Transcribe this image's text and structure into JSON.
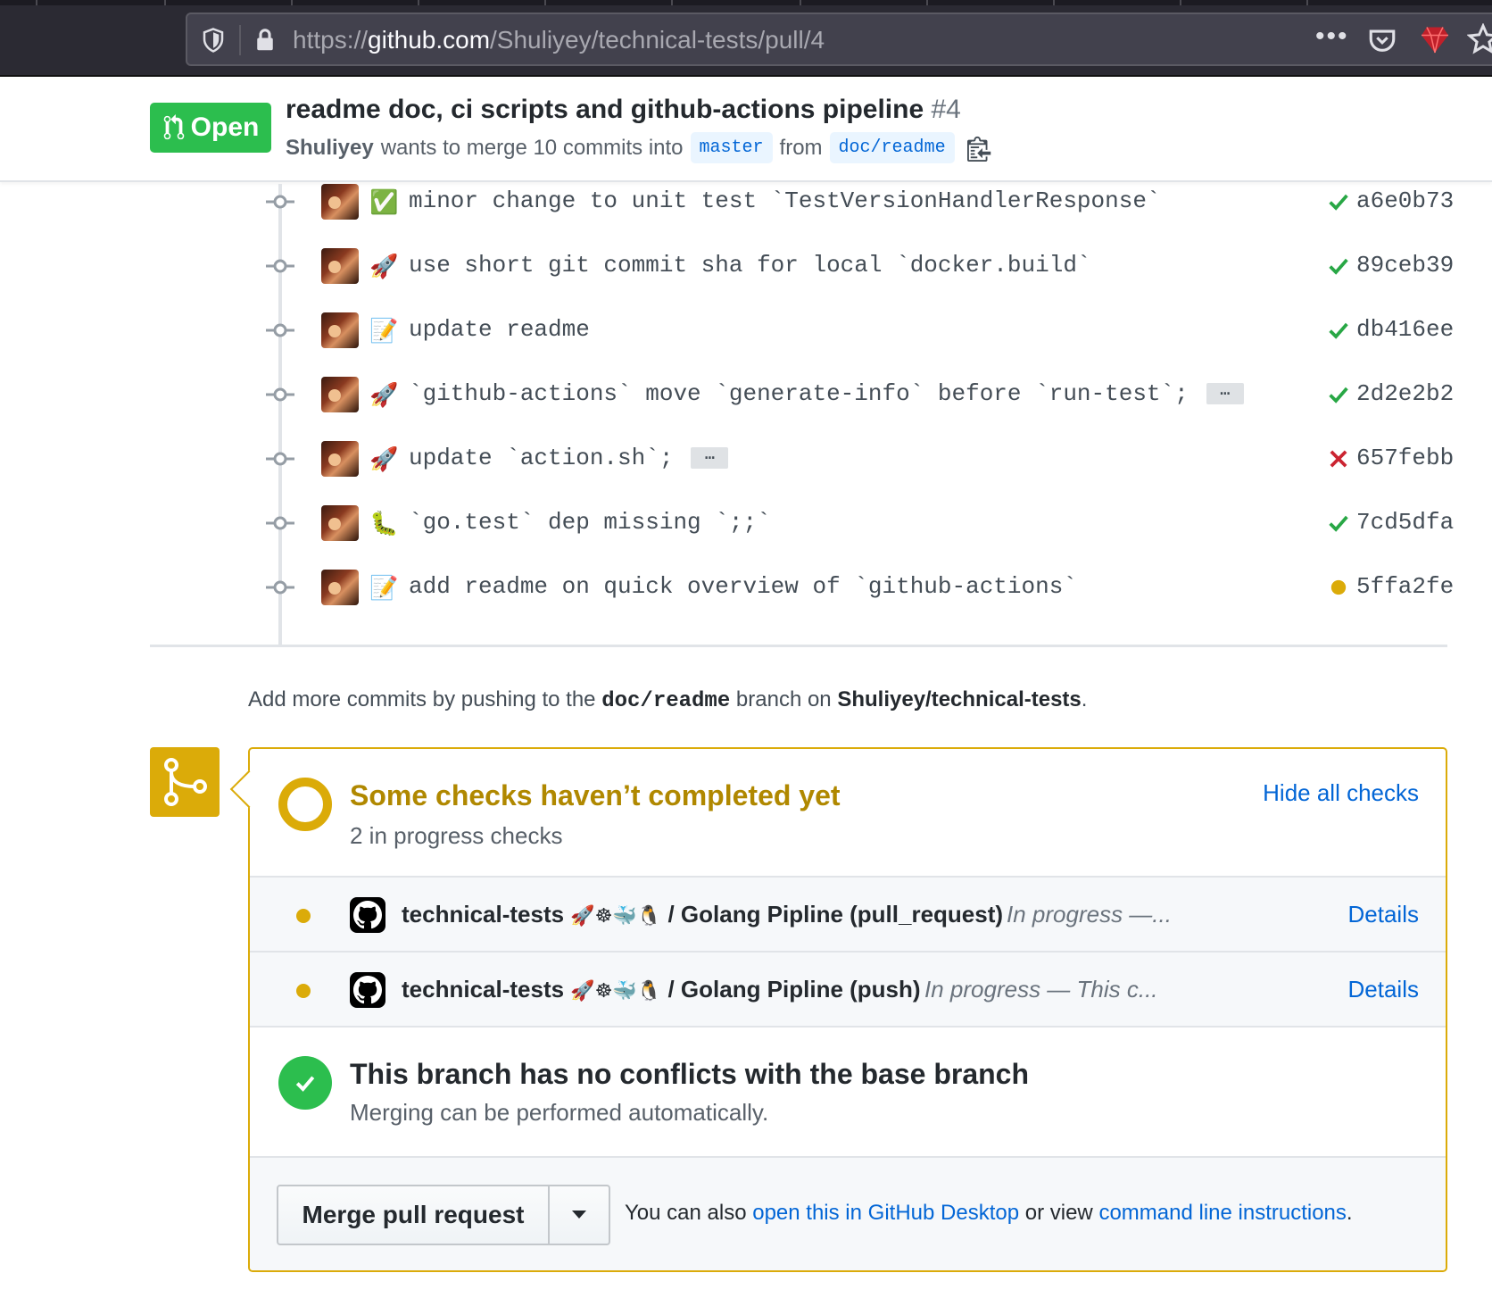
{
  "browser": {
    "url_prefix": "https://",
    "url_host": "github.com",
    "url_path": "/Shuliyey/technical-tests/pull/4",
    "menu_dots": "•••"
  },
  "pr": {
    "state_label": "Open",
    "title": "readme doc, ci scripts and github-actions pipeline",
    "number": "#4",
    "author": "Shuliyey",
    "merge_text_1": "wants to merge 10 commits into",
    "base_branch": "master",
    "merge_text_2": "from",
    "head_branch": "doc/readme"
  },
  "commits": [
    {
      "emoji": "✅",
      "message": "minor change to unit test `TestVersionHandlerResponse`",
      "status": "success",
      "sha": "a6e0b73",
      "expandable": false
    },
    {
      "emoji": "🚀",
      "message": "use short git commit sha for local `docker.build`",
      "status": "success",
      "sha": "89ceb39",
      "expandable": false
    },
    {
      "emoji": "📝",
      "message": "update readme",
      "status": "success",
      "sha": "db416ee",
      "expandable": false
    },
    {
      "emoji": "🚀",
      "message": "`github-actions` move `generate-info` before `run-test`;",
      "status": "success",
      "sha": "2d2e2b2",
      "expandable": true
    },
    {
      "emoji": "🚀",
      "message": "update `action.sh`;",
      "status": "failure",
      "sha": "657febb",
      "expandable": true
    },
    {
      "emoji": "🐛",
      "message": "`go.test` dep missing `;;`",
      "status": "success",
      "sha": "7cd5dfa",
      "expandable": false
    },
    {
      "emoji": "📝",
      "message": "add readme on quick overview of `github-actions`",
      "status": "pending",
      "sha": "5ffa2fe",
      "expandable": false
    }
  ],
  "ellipsis_label": "…",
  "push_hint": {
    "text_1": "Add more commits by pushing to the",
    "branch": "doc/readme",
    "text_2": "branch on",
    "repo": "Shuliyey/technical-tests",
    "text_3": "."
  },
  "checks": {
    "title": "Some checks haven’t completed yet",
    "subtitle": "2 in progress checks",
    "hide_label": "Hide all checks",
    "items": [
      {
        "name": "technical-tests",
        "emojis": "🚀☸🐳🐧",
        "workflow": "/ Golang Pipline (pull_request)",
        "status": "In progress —...",
        "details_label": "Details"
      },
      {
        "name": "technical-tests",
        "emojis": "🚀☸🐳🐧",
        "workflow": "/ Golang Pipline (push)",
        "status": "In progress — This c...",
        "details_label": "Details"
      }
    ]
  },
  "conflicts": {
    "title": "This branch has no conflicts with the base branch",
    "subtitle": "Merging can be performed automatically."
  },
  "merge": {
    "button_label": "Merge pull request",
    "hint_1": "You can also",
    "desktop_link": "open this in GitHub Desktop",
    "hint_2": "or view",
    "cli_link": "command line instructions",
    "hint_3": "."
  },
  "colors": {
    "success": "#28a745",
    "failure": "#cb2431",
    "pending": "#dbab09",
    "link": "#0366d6",
    "open_badge": "#2cbe4e"
  }
}
